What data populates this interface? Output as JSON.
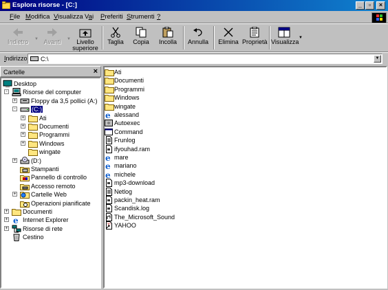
{
  "window": {
    "title": "Esplora risorse - [C:]",
    "title_bar_color": "#000080"
  },
  "menu": [
    {
      "label": "File",
      "accel": "F"
    },
    {
      "label": "Modifica",
      "accel": "M"
    },
    {
      "label": "Visualizza",
      "accel": "V"
    },
    {
      "label": "Vai",
      "accel": "a"
    },
    {
      "label": "Preferiti",
      "accel": "P"
    },
    {
      "label": "Strumenti",
      "accel": "S"
    },
    {
      "label": "?",
      "accel": "?"
    }
  ],
  "toolbar": {
    "back": "Indietro",
    "forward": "Avanti",
    "up_line1": "Livello",
    "up_line2": "superiore",
    "cut": "Taglia",
    "copy": "Copia",
    "paste": "Incolla",
    "undo": "Annulla",
    "delete": "Elimina",
    "properties": "Proprietà",
    "views": "Visualizza"
  },
  "address": {
    "label_prefix": "I",
    "label_rest": "ndirizzo",
    "value": "C:\\"
  },
  "tree": {
    "header": "Cartelle",
    "close_glyph": "×",
    "nodes": [
      {
        "label": "Desktop",
        "icon": "desktop-icon"
      },
      {
        "label": "Risorse del computer",
        "icon": "computer-icon"
      },
      {
        "label": "Floppy da 3,5 pollici (A:)",
        "icon": "floppy-icon"
      },
      {
        "label": "(C:)",
        "icon": "hard-drive-icon",
        "selected": true
      },
      {
        "label": "Ati",
        "icon": "folder-icon"
      },
      {
        "label": "Documenti",
        "icon": "folder-icon"
      },
      {
        "label": "Programmi",
        "icon": "folder-icon"
      },
      {
        "label": "Windows",
        "icon": "folder-icon"
      },
      {
        "label": "wingate",
        "icon": "folder-icon"
      },
      {
        "label": "(D:)",
        "icon": "cd-drive-icon"
      },
      {
        "label": "Stampanti",
        "icon": "printers-icon"
      },
      {
        "label": "Pannello di controllo",
        "icon": "control-panel-icon"
      },
      {
        "label": "Accesso remoto",
        "icon": "dialup-icon"
      },
      {
        "label": "Cartelle Web",
        "icon": "web-folders-icon"
      },
      {
        "label": "Operazioni pianificate",
        "icon": "scheduled-tasks-icon"
      },
      {
        "label": "Documenti",
        "icon": "my-documents-icon"
      },
      {
        "label": "Internet Explorer",
        "icon": "ie-icon"
      },
      {
        "label": "Risorse di rete",
        "icon": "network-icon"
      },
      {
        "label": "Cestino",
        "icon": "recycle-bin-icon"
      }
    ]
  },
  "files": [
    {
      "name": "Ati",
      "icon": "folder-icon"
    },
    {
      "name": "Documenti",
      "icon": "folder-icon"
    },
    {
      "name": "Programmi",
      "icon": "folder-icon"
    },
    {
      "name": "Windows",
      "icon": "folder-icon"
    },
    {
      "name": "wingate",
      "icon": "folder-icon"
    },
    {
      "name": "alessand",
      "icon": "ie-file-icon"
    },
    {
      "name": "Autoexec",
      "icon": "batch-file-icon"
    },
    {
      "name": "Command",
      "icon": "msdos-program-icon"
    },
    {
      "name": "Frunlog",
      "icon": "text-file-icon"
    },
    {
      "name": "ifyouhad.ram",
      "icon": "generic-file-icon"
    },
    {
      "name": "mare",
      "icon": "ie-file-icon"
    },
    {
      "name": "mariano",
      "icon": "ie-file-icon"
    },
    {
      "name": "michele",
      "icon": "ie-file-icon"
    },
    {
      "name": "mp3-download",
      "icon": "generic-file-icon"
    },
    {
      "name": "Netlog",
      "icon": "text-file-icon"
    },
    {
      "name": "packin_heat.ram",
      "icon": "generic-file-icon"
    },
    {
      "name": "Scandisk.log",
      "icon": "generic-file-icon"
    },
    {
      "name": "The_Microsoft_Sound",
      "icon": "sound-file-icon"
    },
    {
      "name": "YAHOO",
      "icon": "shortcut-file-icon"
    }
  ]
}
